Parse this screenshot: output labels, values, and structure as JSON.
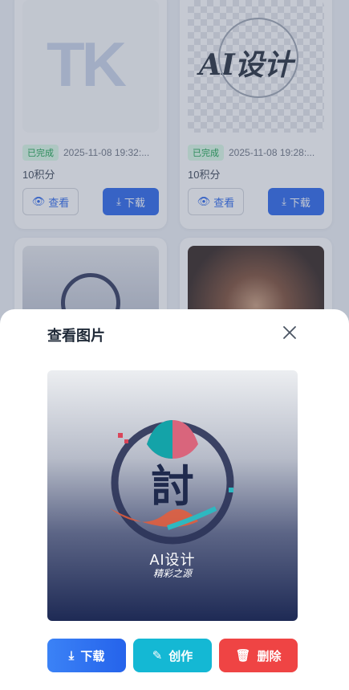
{
  "cards": [
    {
      "status": "已完成",
      "time": "2025-11-08 19:32:...",
      "points": "10积分",
      "view_label": "查看",
      "download_label": "下载"
    },
    {
      "status": "已完成",
      "time": "2025-11-08 19:28:...",
      "points": "10积分",
      "view_label": "查看",
      "download_label": "下载"
    }
  ],
  "card1_logo_text": "TK",
  "card2_logo_text": "AI设计",
  "modal": {
    "title": "查看图片",
    "image_caption": "AI设计",
    "image_subcaption": "精彩之源",
    "image_glyph": "討",
    "download_label": "下载",
    "create_label": "创作",
    "delete_label": "删除"
  },
  "colors": {
    "primary": "#2563eb",
    "create": "#14b8d4",
    "delete": "#ef4444",
    "badge_bg": "#dcfce7",
    "badge_text": "#16a34a"
  }
}
